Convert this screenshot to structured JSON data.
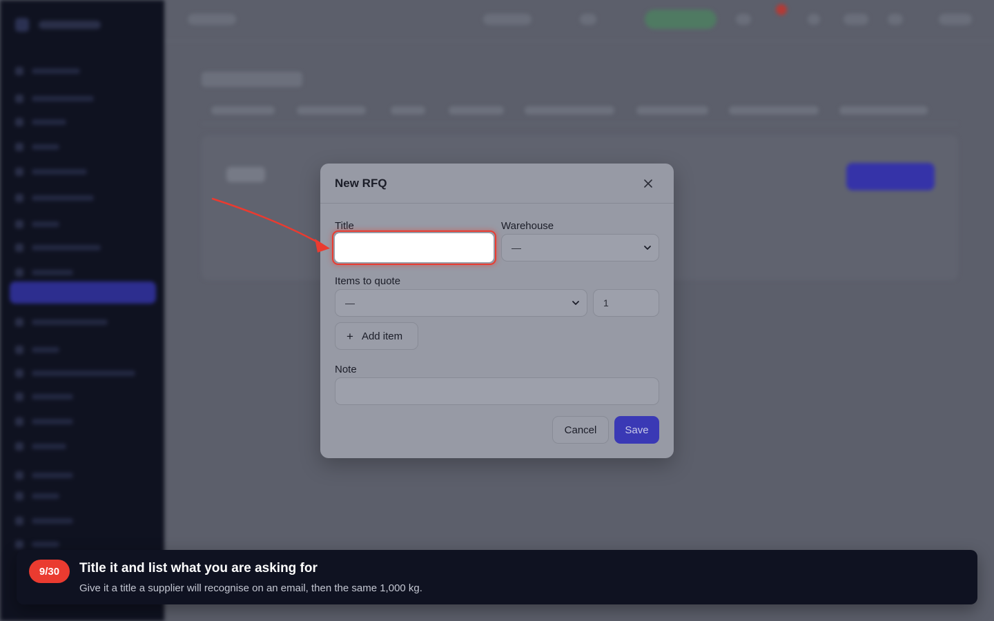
{
  "modal": {
    "title": "New RFQ",
    "fields": {
      "title_label": "Title",
      "title_value": "",
      "warehouse_label": "Warehouse",
      "warehouse_value": "—",
      "items_label": "Items to quote",
      "item_value": "—",
      "quantity_value": "1",
      "add_item_label": "Add item",
      "note_label": "Note",
      "note_value": ""
    },
    "actions": {
      "cancel_label": "Cancel",
      "save_label": "Save"
    }
  },
  "tour": {
    "step": "9/30",
    "title": "Title it and list what you are asking for",
    "description": "Give it a title a supplier will recognise on an email, then the same 1,000 kg."
  },
  "colors": {
    "highlight": "#ea3b30",
    "primary": "#3a39b5",
    "tour_bg": "#0f1221"
  },
  "icons": {
    "close": "close-icon",
    "chevron": "chevron-down-icon",
    "plus": "plus-icon",
    "pointer": "arrow-pointer-icon"
  }
}
